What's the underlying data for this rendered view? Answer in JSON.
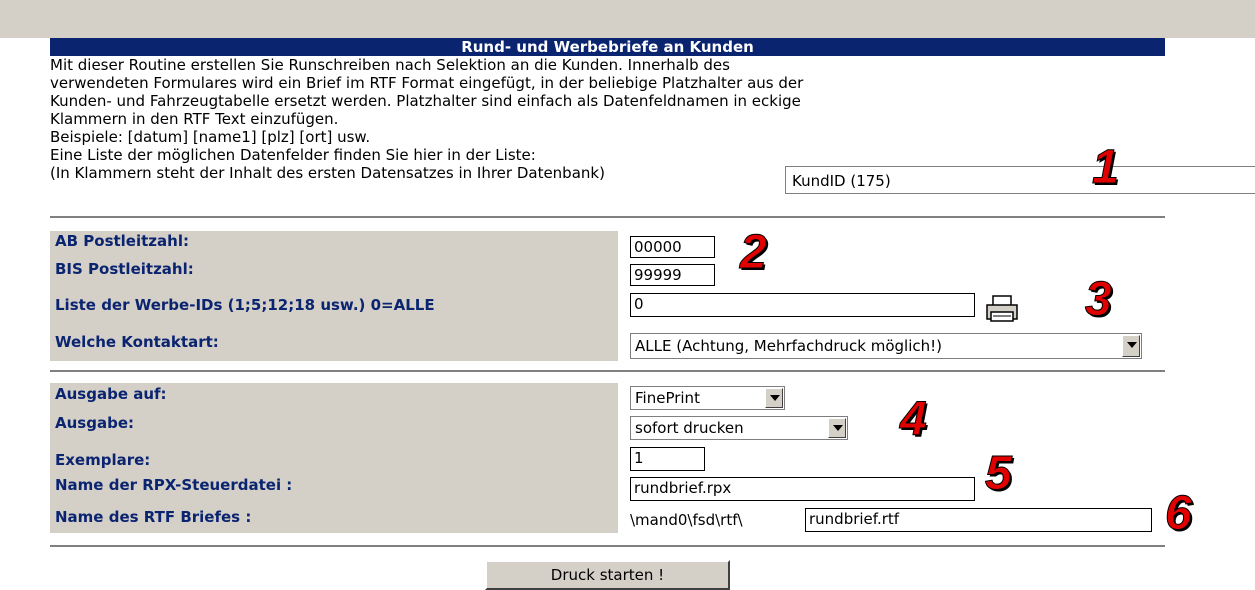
{
  "title": "Rund- und Werbebriefe an Kunden",
  "intro": {
    "lines": [
      "Mit dieser Routine erstellen Sie Runschreiben nach Selektion an die Kunden. Innerhalb des",
      "verwendeten Formulares wird ein Brief im RTF Format eingefügt, in der beliebige Platzhalter aus der",
      "Kunden- und Fahrzeugtabelle ersetzt werden. Platzhalter sind einfach als Datenfeldnamen in eckige",
      "Klammern in den RTF Text einzufügen.",
      "Beispiele: [datum] [name1] [plz] [ort] usw.",
      "Eine Liste der möglichen Datenfelder finden Sie hier in der Liste:",
      "(In Klammern steht der Inhalt des ersten Datensatzes in Ihrer Datenbank)"
    ],
    "field_list_value": "KundID (175)"
  },
  "selection": {
    "plz_from_label": "AB Postleitzahl:",
    "plz_from_value": "00000",
    "plz_to_label": "BIS Postleitzahl:",
    "plz_to_value": "99999",
    "werbe_ids_label": "Liste der Werbe-IDs (1;5;12;18 usw.) 0=ALLE",
    "werbe_ids_value": "0",
    "kontaktart_label": "Welche Kontaktart:",
    "kontaktart_value": "ALLE (Achtung, Mehrfachdruck möglich!)"
  },
  "output": {
    "ausgabe_auf_label": "Ausgabe auf:",
    "ausgabe_auf_value": "FinePrint",
    "ausgabe_label": "Ausgabe:",
    "ausgabe_value": "sofort drucken",
    "exemplare_label": "Exemplare:",
    "exemplare_value": "1",
    "rpx_label": "Name der RPX-Steuerdatei :",
    "rpx_value": "rundbrief.rpx",
    "rtf_label": "Name des RTF Briefes :",
    "rtf_prefix": "\\mand0\\fsd\\rtf\\",
    "rtf_value": "rundbrief.rtf"
  },
  "annotations": [
    "1",
    "2",
    "3",
    "4",
    "5",
    "6"
  ],
  "button_label": "Druck starten !",
  "icons": {
    "werbe_ids": "printer-icon"
  }
}
